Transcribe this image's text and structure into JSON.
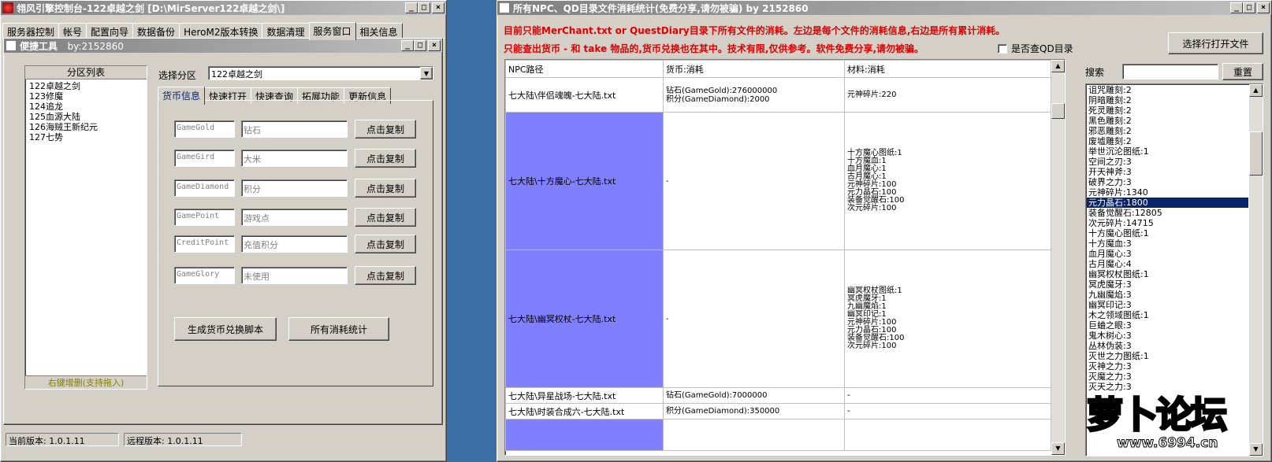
{
  "left_window": {
    "title": "翎风引擎控制台-122卓越之剑 [D:\\MirServer122卓越之剑\\]",
    "tabs": [
      "服务器控制",
      "帐号",
      "配置向导",
      "数据备份",
      "HeroM2版本转换",
      "数据清理",
      "服务窗口",
      "相关信息"
    ],
    "selected_tab": "服务窗口",
    "status_local": "当前版本: 1.0.1.11",
    "status_remote": "远程版本: 1.0.1.11"
  },
  "tool_window": {
    "title": "便捷工具",
    "author": "by:2152860",
    "partition_header": "分区列表",
    "partitions": [
      "122卓越之剑",
      "123修魔",
      "124追龙",
      "125血源大陆",
      "126海贼王新纪元",
      "127七势"
    ],
    "partition_footer": "右键增删(支持拖入)",
    "select_label": "选择分区",
    "select_value": "122卓越之剑",
    "subtabs": [
      "货币信息",
      "快速打开",
      "快速查询",
      "拓展功能",
      "更新信息"
    ],
    "selected_subtab": "货币信息",
    "currency_rows": [
      {
        "code": "GameGold",
        "name": "钻石",
        "button": "点击复制"
      },
      {
        "code": "GameGird",
        "name": "大米",
        "button": "点击复制"
      },
      {
        "code": "GameDiamond",
        "name": "积分",
        "button": "点击复制"
      },
      {
        "code": "GamePoint",
        "name": "游戏点",
        "button": "点击复制"
      },
      {
        "code": "CreditPoint",
        "name": "充值积分",
        "button": "点击复制"
      },
      {
        "code": "GameGlory",
        "name": "未使用",
        "button": "点击复制"
      }
    ],
    "btn_generate": "生成货币兑换脚本",
    "btn_stats": "所有消耗统计"
  },
  "right_window": {
    "title": "所有NPC、QD目录文件消耗统计(免费分享,请勿被骗)   by 2152860",
    "notice1": "目前只能MerChant.txt or QuestDiary目录下所有文件的消耗。左边是每个文件的消耗信息,右边是所有累计消耗。",
    "notice2": "只能查出货币 - 和 take 物品的,货币兑换也在其中。技术有限,仅供参考。软件免费分享,请勿被骗。",
    "checkbox_label": "是否查QD目录",
    "open_button": "选择行打开文件",
    "search_label": "搜索",
    "reset_button": "重置",
    "columns": [
      "NPC路径",
      "货币:消耗",
      "材料:消耗"
    ],
    "rows": [
      {
        "path": "七大陆\\伴侣魂魄-七大陆.txt",
        "currency": [
          "钻石(GameGold):276000000",
          "积分(GameDiamond):2000"
        ],
        "materials": [
          "元神碎片:220"
        ],
        "highlight": false
      },
      {
        "path": "七大陆\\十方魔心-七大陆.txt",
        "currency": [
          "-"
        ],
        "materials": [
          "十方魔心图纸:1",
          "十方魔血:1",
          "血月魔心:1",
          "古月魔心:1",
          "元神碎片:100",
          "元力晶石:100",
          "装备觉醒石:100",
          "次元碎片:100"
        ],
        "highlight": true
      },
      {
        "path": "七大陆\\幽冥权杖-七大陆.txt",
        "currency": [
          "-"
        ],
        "materials": [
          "幽冥权杖图纸:1",
          "冥虎魔牙:1",
          "九幽魔焰:1",
          "幽冥印记:1",
          "元神碎片:100",
          "元力晶石:100",
          "装备觉醒石:100",
          "次元碎片:100"
        ],
        "highlight": true
      },
      {
        "path": "七大陆\\异星战场-七大陆.txt",
        "currency": [
          "钻石(GameGold):7000000"
        ],
        "materials": [
          "-"
        ],
        "highlight": false
      },
      {
        "path": "七大陆\\时装合成六-七大陆.txt",
        "currency": [
          "积分(GameDiamond):350000"
        ],
        "materials": [
          "-"
        ],
        "highlight": false
      }
    ],
    "totals": [
      "诅咒雕刻:2",
      "阴暗雕刻:2",
      "死灵雕刻:2",
      "黑色雕刻:2",
      "邪恶雕刻:2",
      "废墟雕刻:2",
      "举世沉沦图纸:1",
      "空间之刃:3",
      "开天神斧:3",
      "破界之力:3",
      "元神碎片:1340",
      "元力晶石:1800",
      "装备觉醒石:12805",
      "次元碎片:14715",
      "十方魔心图纸:1",
      "十方魔血:3",
      "血月魔心:3",
      "古月魔心:4",
      "幽冥权杖图纸:1",
      "冥虎魔牙:3",
      "九幽魔焰:3",
      "幽冥印记:3",
      "木之领域图纸:1",
      "巨蛐之眼:3",
      "鬼木树心:3",
      "丛林伪装:3",
      "灭世之力图纸:1",
      "灭神之力:3",
      "灭魔之力:3",
      "灭天之力:3"
    ],
    "totals_selected": "元力晶石:1800"
  },
  "watermark": {
    "name": "萝卜论坛",
    "url": "www.6994.cn"
  },
  "colors": {
    "highlight_row": "#8080ff",
    "selection": "#0a246a",
    "notice": "#e00000"
  }
}
